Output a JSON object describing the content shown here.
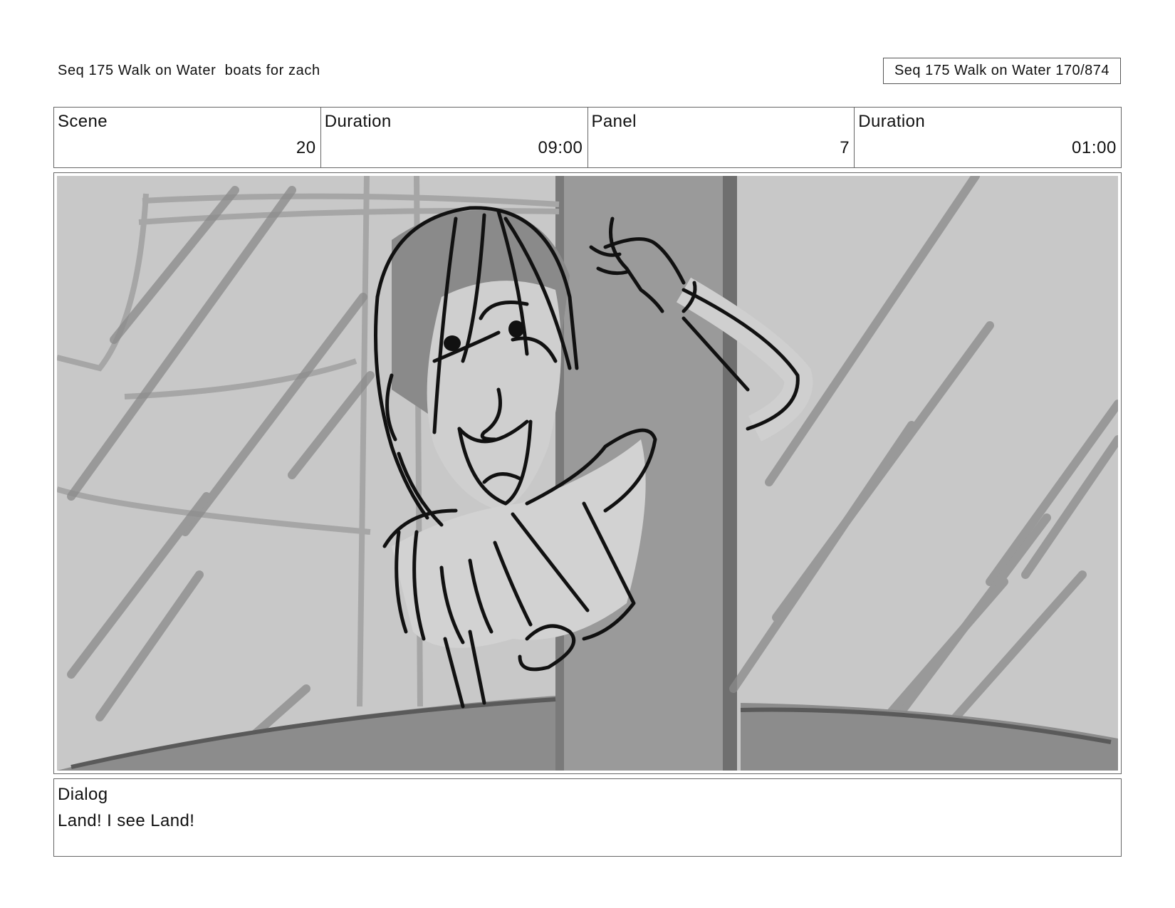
{
  "header": {
    "sequence_title": "Seq 175 Walk on Water  boats for zach",
    "page_ref": "Seq 175 Walk on Water 170/874"
  },
  "info": {
    "scene_label": "Scene",
    "scene_value": "20",
    "scene_duration_label": "Duration",
    "scene_duration_value": "09:00",
    "panel_label": "Panel",
    "panel_value": "7",
    "panel_duration_label": "Duration",
    "panel_duration_value": "01:00"
  },
  "dialog": {
    "label": "Dialog",
    "text": "Land! I see Land!"
  },
  "colors": {
    "sketch_background": "#c8c8c8",
    "mast": "#999999",
    "ink": "#111111"
  }
}
